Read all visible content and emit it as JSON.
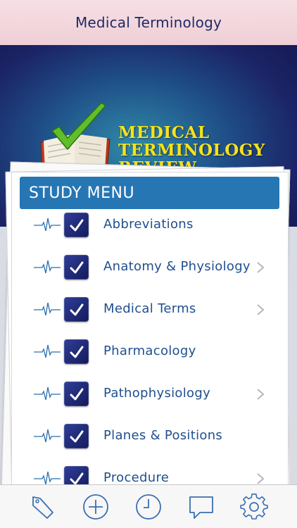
{
  "navbar": {
    "title": "Medical Terminology"
  },
  "logo": {
    "line1": "MEDICAL",
    "line2": "TERMINOLOGY",
    "line3": "REVIEW"
  },
  "menu": {
    "header": "STUDY MENU",
    "items": [
      {
        "label": "Abbreviations",
        "has_chevron": false
      },
      {
        "label": "Anatomy & Physiology",
        "has_chevron": true
      },
      {
        "label": "Medical Terms",
        "has_chevron": true
      },
      {
        "label": "Pharmacology",
        "has_chevron": false
      },
      {
        "label": "Pathophysiology",
        "has_chevron": true
      },
      {
        "label": "Planes & Positions",
        "has_chevron": false
      },
      {
        "label": "Procedure",
        "has_chevron": true
      }
    ]
  },
  "tabbar": {
    "tabs": [
      {
        "icon": "bookmark-icon"
      },
      {
        "icon": "add-icon"
      },
      {
        "icon": "clock-icon"
      },
      {
        "icon": "chat-icon"
      },
      {
        "icon": "gear-icon"
      }
    ]
  },
  "colors": {
    "accent": "#2776b4",
    "title_text": "#1f2a68",
    "item_text": "#1f4f8e",
    "logo_text": "#f6e21c",
    "check_green": "#5fbf2a"
  }
}
